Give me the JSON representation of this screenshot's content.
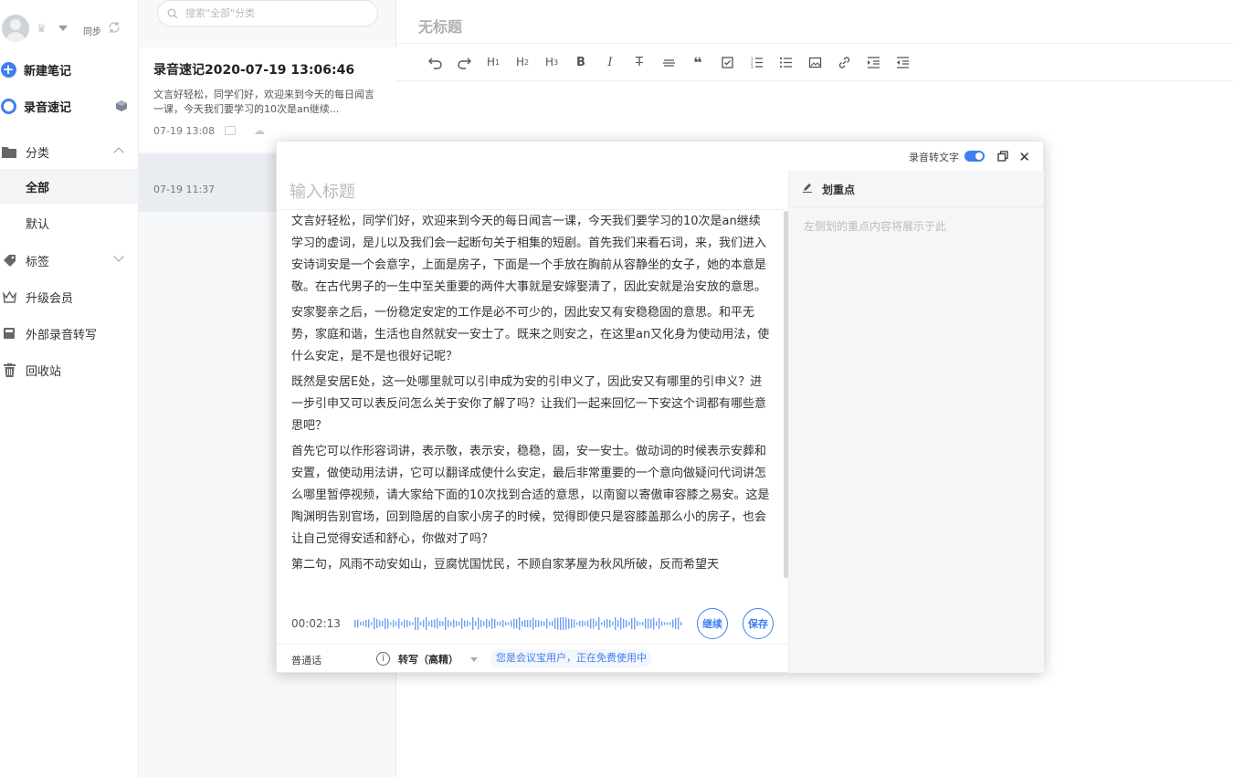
{
  "sidebar": {
    "sync_label": "同步",
    "new_note": "新建笔记",
    "voice_memo": "录音速记",
    "categories": "分类",
    "all": "全部",
    "default": "默认",
    "tags": "标签",
    "upgrade": "升级会员",
    "external": "外部录音转写",
    "trash": "回收站"
  },
  "notelist": {
    "search_placeholder": "搜索\"全部\"分类",
    "notes": [
      {
        "title": "录音速记2020-07-19 13:06:46",
        "snippet": "文言好轻松，同学们好，欢迎来到今天的每日闻言一课，今天我们要学习的10次是an继续...",
        "date": "07-19 13:08"
      },
      {
        "title": "",
        "snippet": "",
        "date": "07-19 11:37"
      }
    ]
  },
  "editor": {
    "title": "无标题",
    "toolbar": [
      "undo",
      "redo",
      "H1",
      "H2",
      "H3",
      "B",
      "I",
      "strike",
      "hr",
      "quote",
      "checkbox",
      "ordered-list",
      "bullet-list",
      "image",
      "link",
      "indent",
      "outdent"
    ]
  },
  "modal": {
    "toggle_label": "录音转文字",
    "title_placeholder": "输入标题",
    "paragraphs": [
      "文言好轻松，同学们好，欢迎来到今天的每日闻言一课，今天我们要学习的10次是an继续学习的虚词，是儿以及我们会一起断句关于相集的短剧。首先我们来看石词，来，我们进入安诗词安是一个会意字，上面是房子，下面是一个手放在胸前从容静坐的女子，她的本意是敬。在古代男子的一生中至关重要的两件大事就是安嫁娶清了，因此安就是治安放的意思。",
      "安家娶亲之后，一份稳定安定的工作是必不可少的，因此安又有安稳稳固的意思。和平无势，家庭和谐，生活也自然就安一安士了。既来之则安之，在这里an又化身为使动用法，使什么安定，是不是也很好记呢？",
      "既然是安居E处，这一处哪里就可以引申成为安的引申义了，因此安又有哪里的引申义？进一步引申又可以表反问怎么关于安你了解了吗？让我们一起来回忆一下安这个词都有哪些意思吧？",
      "首先它可以作形容词讲，表示敬，表示安，稳稳，固，安一安士。做动词的时候表示安葬和安置，做使动用法讲，它可以翻译成使什么安定，最后非常重要的一个意向做疑问代词讲怎么哪里暂停视频，请大家给下面的10次找到合适的意思，以南窗以寄傲审容膝之易安。这是陶渊明告别官场，回到隐居的自家小房子的时候，觉得即使只是容膝盖那么小的房子，也会让自己觉得安适和舒心，你做对了吗？",
      "第二句，风雨不动安如山，豆腐忧国忧民，不顾自家茅屋为秋风所破，反而希望天"
    ],
    "time": "00:02:13",
    "continue_label": "继续",
    "save_label": "保存",
    "language": "普通话",
    "mode": "转写（高精）",
    "free_note": "您是会议宝用户，正在免费使用中",
    "highlight_title": "划重点",
    "highlight_empty": "左侧划的重点内容将展示于此"
  },
  "colors": {
    "accent": "#3f7ff0"
  }
}
